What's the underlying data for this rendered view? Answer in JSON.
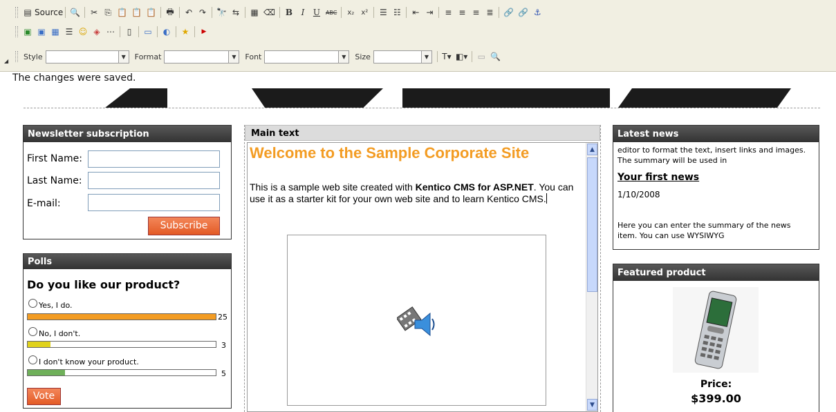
{
  "toolbar": {
    "source_label": "Source",
    "style_label": "Style",
    "format_label": "Format",
    "font_label": "Font",
    "size_label": "Size",
    "bold": "B",
    "italic": "I",
    "underline": "U",
    "strike": "ABC",
    "subscript": "x₂",
    "superscript": "x²"
  },
  "status_message": "The changes were saved.",
  "newsletter": {
    "title": "Newsletter subscription",
    "first_name_label": "First Name:",
    "last_name_label": "Last Name:",
    "email_label": "E-mail:",
    "subscribe_label": "Subscribe"
  },
  "polls": {
    "title": "Polls",
    "question": "Do you like our product?",
    "answers": [
      {
        "label": "Yes, I do.",
        "count": "25",
        "fraction": 1.0,
        "color": "#f39c23"
      },
      {
        "label": "No, I don't.",
        "count": "3",
        "fraction": 0.12,
        "color": "#e0d21b"
      },
      {
        "label": "I don't know your product.",
        "count": "5",
        "fraction": 0.2,
        "color": "#6fb05a"
      }
    ],
    "vote_label": "Vote"
  },
  "main": {
    "header": "Main text",
    "heading": "Welcome to the Sample Corporate Site",
    "para_pre": "This is a sample web site created with ",
    "para_bold": "Kentico CMS for ASP.NET",
    "para_post": ". You can use it as a starter kit for your own web site and to learn Kentico CMS."
  },
  "news": {
    "title": "Latest news",
    "summary_top": "editor to format the text, insert links and images. The summary will be used in",
    "item_title": "Your first news",
    "item_date": "1/10/2008",
    "summary_bottom": "Here you can enter the summary of the news item. You can use WYSIWYG"
  },
  "featured": {
    "title": "Featured product",
    "price_label": "Price:",
    "price_value": "$399.00"
  },
  "colors": {
    "heading_orange": "#f39c23",
    "panel_header": "#333333"
  }
}
